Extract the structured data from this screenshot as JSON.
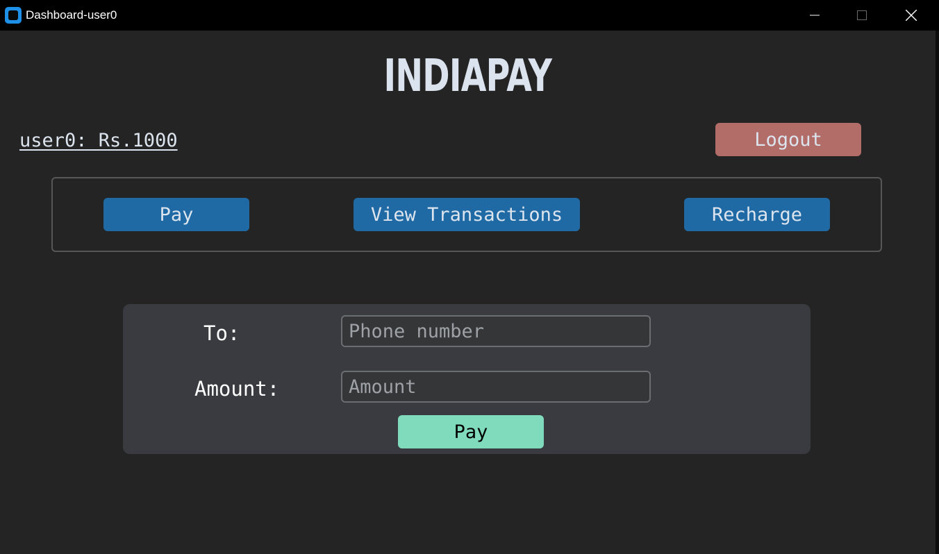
{
  "window": {
    "title": "Dashboard-user0"
  },
  "header": {
    "brand": "INDIAPAY"
  },
  "account": {
    "balance_text": "user0: Rs.1000",
    "logout_label": "Logout"
  },
  "nav": {
    "pay_label": "Pay",
    "transactions_label": "View Transactions",
    "recharge_label": "Recharge"
  },
  "pay_form": {
    "to_label": "To:",
    "to_placeholder": "Phone number",
    "amount_label": "Amount:",
    "amount_placeholder": "Amount",
    "submit_label": "Pay"
  },
  "colors": {
    "background": "#242424",
    "primary_button": "#1f6aa5",
    "logout_button": "#b36d69",
    "submit_button": "#7fdbbb",
    "panel": "#393b40"
  },
  "icons": {
    "app": "app-icon",
    "minimize": "minimize-icon",
    "maximize": "maximize-icon",
    "close": "close-icon"
  }
}
